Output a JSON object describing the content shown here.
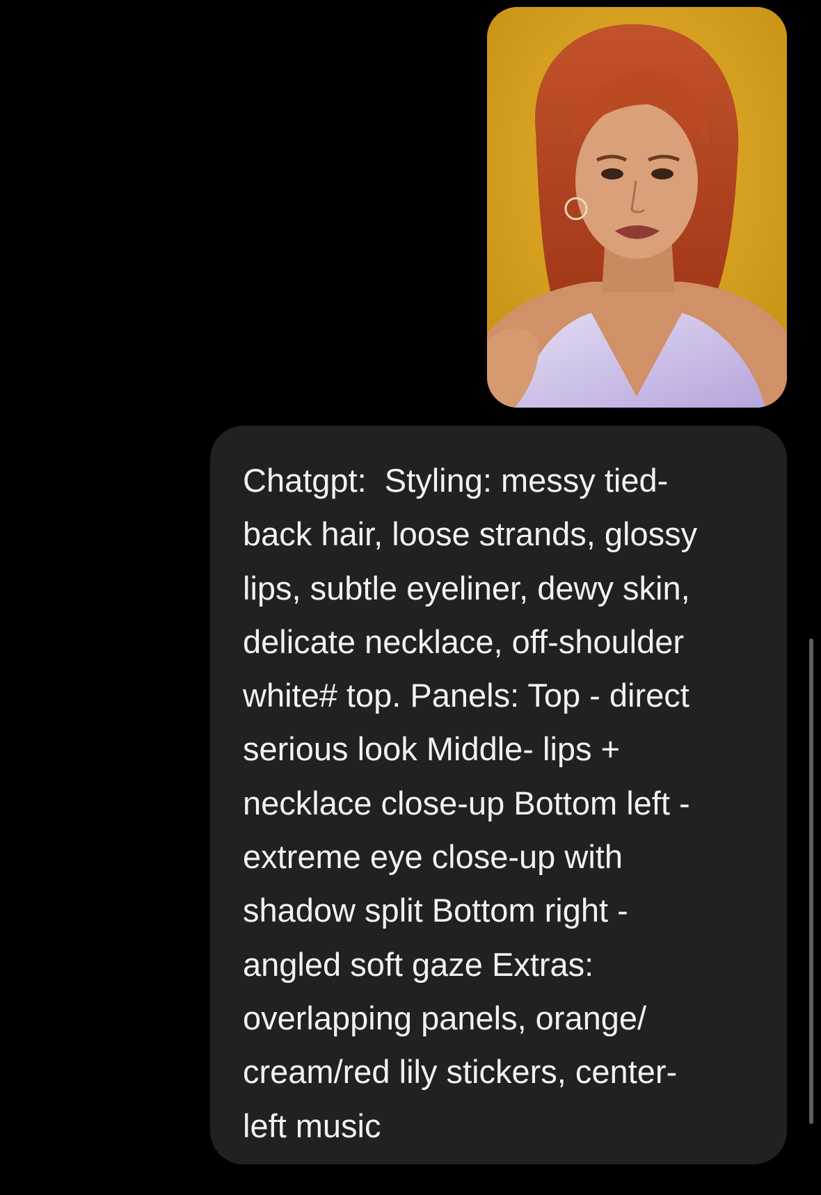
{
  "thread": {
    "photo": {
      "icon": "portrait-photo",
      "colors": {
        "background": "#d9a21f",
        "hair": "#b8431f",
        "skin": "#d79b72",
        "top": "#cdbfe8"
      }
    },
    "message": {
      "lines": [
        "Chatgpt:  Styling: messy tied-",
        "back hair, loose strands, glossy",
        "lips, subtle eyeliner, dewy skin,",
        "delicate necklace, off-shoulder",
        "white# top. Panels: Top - direct",
        "serious look Middle- lips +",
        "necklace close-up Bottom left -",
        "extreme eye close-up with",
        "shadow split Bottom right -",
        "angled soft gaze Extras:",
        "overlapping panels, orange/",
        "cream/red lily stickers, center-",
        "left music"
      ]
    }
  },
  "colors": {
    "page_background": "#000000",
    "bubble_background": "#212121",
    "bubble_text": "#f2f2f2",
    "scrollbar": "#5d5d5d"
  }
}
